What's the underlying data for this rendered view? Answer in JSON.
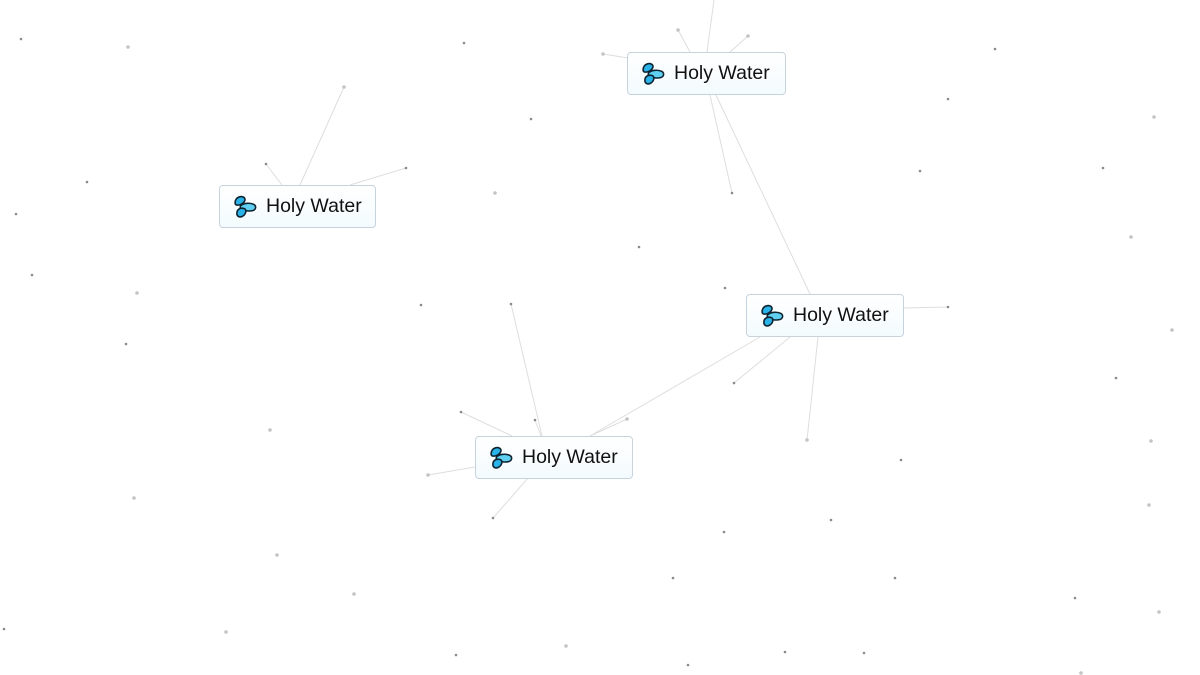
{
  "app": {
    "background_color": "#ffffff",
    "tile_border_color": "#c7d3dc",
    "line_color": "#dedede",
    "dot_colors": [
      "#8a8a8a",
      "#c4c4c4"
    ]
  },
  "tiles": [
    {
      "id": "tile-top",
      "label": "Holy Water",
      "icon": "water-droplets-icon"
    },
    {
      "id": "tile-left",
      "label": "Holy Water",
      "icon": "water-droplets-icon"
    },
    {
      "id": "tile-right",
      "label": "Holy Water",
      "icon": "water-droplets-icon"
    },
    {
      "id": "tile-bottom",
      "label": "Holy Water",
      "icon": "water-droplets-icon"
    }
  ],
  "icon_colors": {
    "fill_primary": "#2ab3e8",
    "fill_secondary": "#5fcff2",
    "outline": "#0d2330"
  }
}
